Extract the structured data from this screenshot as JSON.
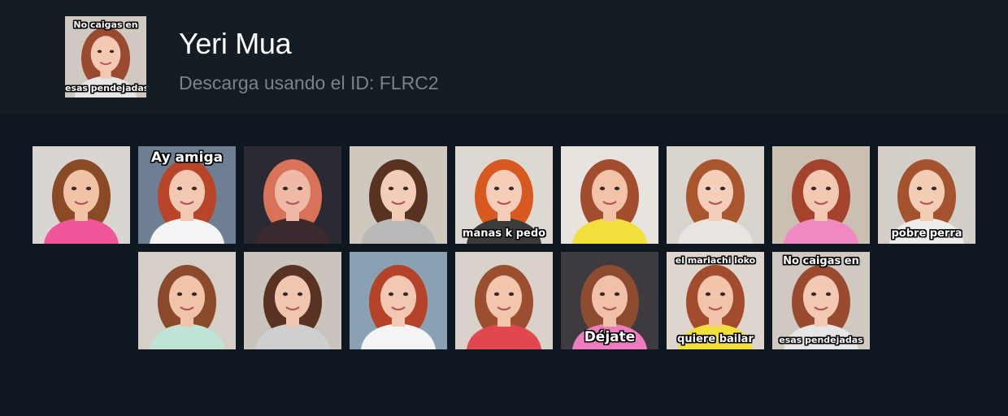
{
  "header": {
    "title": "Yeri Mua",
    "subtitle": "Descarga usando el ID: FLRC2",
    "thumb": {
      "top_caption": "No caigas en",
      "bottom_caption": "esas pendejadas"
    }
  },
  "stickers": [
    {
      "bg": "#d9d6d2",
      "hair": "#8a4a26",
      "skin": "#f1c3a6",
      "cloth": "#f0559a",
      "top_caption": "",
      "bottom_caption": ""
    },
    {
      "bg": "#6f7f93",
      "hair": "#b8452a",
      "skin": "#f2c8b2",
      "cloth": "#f4f4f4",
      "top_caption": "Ay amiga",
      "bottom_caption": ""
    },
    {
      "bg": "#2b2a33",
      "hair": "#d8735a",
      "skin": "#f0b9a6",
      "cloth": "#3a2a2e",
      "top_caption": "",
      "bottom_caption": ""
    },
    {
      "bg": "#cfc8bf",
      "hair": "#5a3222",
      "skin": "#f3cdb8",
      "cloth": "#b9b9b9",
      "top_caption": "",
      "bottom_caption": ""
    },
    {
      "bg": "#ddd8d1",
      "hair": "#d7591f",
      "skin": "#f5cdb8",
      "cloth": "#3b3b3b",
      "top_caption": "",
      "bottom_caption": "manas k pedo"
    },
    {
      "bg": "#e7e4e0",
      "hair": "#a24d2d",
      "skin": "#f2c3a8",
      "cloth": "#f1df3a",
      "top_caption": "",
      "bottom_caption": ""
    },
    {
      "bg": "#d9d4ce",
      "hair": "#a9562e",
      "skin": "#f5cfb9",
      "cloth": "#e8e4e1",
      "top_caption": "",
      "bottom_caption": ""
    },
    {
      "bg": "#cbbfb1",
      "hair": "#a3432b",
      "skin": "#f3c9b4",
      "cloth": "#f089c3",
      "top_caption": "",
      "bottom_caption": ""
    },
    {
      "bg": "#d3cec8",
      "hair": "#a5532f",
      "skin": "#f3cdb4",
      "cloth": "#ececec",
      "top_caption": "",
      "bottom_caption": "pobre perra"
    },
    {
      "bg": "#d5cfc8",
      "hair": "#8b4a2c",
      "skin": "#f1c4aa",
      "cloth": "#bfe3d4",
      "top_caption": "",
      "bottom_caption": ""
    },
    {
      "bg": "#cac4bd",
      "hair": "#5a3223",
      "skin": "#f1c6ae",
      "cloth": "#cfcfcf",
      "top_caption": "",
      "bottom_caption": ""
    },
    {
      "bg": "#8aa1b4",
      "hair": "#b4432a",
      "skin": "#f2c8b4",
      "cloth": "#f4f4f4",
      "top_caption": "",
      "bottom_caption": ""
    },
    {
      "bg": "#d8d2cb",
      "hair": "#9c4f2f",
      "skin": "#f1c6ad",
      "cloth": "#e2474f",
      "top_caption": "",
      "bottom_caption": ""
    },
    {
      "bg": "#3d3b3f",
      "hair": "#8d4b30",
      "skin": "#f0c1a8",
      "cloth": "#ef7cc0",
      "top_caption": "",
      "bottom_caption": "Déjate"
    },
    {
      "bg": "#dcd6cf",
      "hair": "#a34c2d",
      "skin": "#f2c4aa",
      "cloth": "#f1df3a",
      "top_caption": "el mariachi loko",
      "bottom_caption": "quiere bailar"
    },
    {
      "bg": "#cfc9c2",
      "hair": "#9a4b2f",
      "skin": "#f3c9b3",
      "cloth": "#e6e6e6",
      "top_caption": "No caigas en",
      "bottom_caption": "esas pendejadas"
    }
  ]
}
